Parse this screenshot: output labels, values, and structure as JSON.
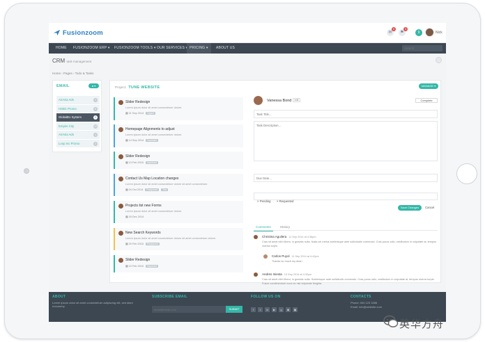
{
  "brand": {
    "name": "Fusionzoom"
  },
  "topbar": {
    "badge1": "5",
    "badge2": "3",
    "green_badge": "9",
    "user": "Nick"
  },
  "nav": {
    "items": [
      "HOME",
      "FUSIONZOOM ERP ▾",
      "FUSIONZOOM TOOLS ▾",
      "OUR SERVICES ▾",
      "PRICING ▾",
      "ABOUT US"
    ],
    "search_placeholder": "Search"
  },
  "page": {
    "title": "CRM",
    "subtitle": "task management",
    "breadcrumb": "Home  ›  Pages  ›  Todo & Tasks"
  },
  "sidebar": {
    "title": "EMAIL",
    "toggle": "● ▾",
    "items": [
      {
        "label": "AirAsia Ads",
        "count": "3"
      },
      {
        "label": "HSBC Promo",
        "count": "5"
      },
      {
        "label": "GlobalEx System",
        "count": "2"
      },
      {
        "label": "Empire City",
        "count": "10"
      },
      {
        "label": "AirAsia Ads",
        "count": "4"
      },
      {
        "label": "Loop Inc Promo",
        "count": "2"
      }
    ]
  },
  "main": {
    "project_label": "Project:",
    "project_name": "TUNE WEBSITE",
    "manage_label": "MANAGE ▾"
  },
  "tasks": [
    {
      "title": "Slider Redesign",
      "desc": "Lorem ipsum dolor sit amet consectetuer dolore.",
      "date": "21 Sep 2014",
      "tag": "Urgent"
    },
    {
      "title": "Homepage Alignments to adjust",
      "desc": "Lorem ipsum dolor sit amet consectetuer dolore.",
      "date": "14 Sep 2014",
      "tag": "Important"
    },
    {
      "title": "Slider Redesign",
      "desc": "",
      "date": "10 Feb 2015",
      "tag": "Important"
    },
    {
      "title": "Contact Us Map Location changes",
      "desc": "Lorem ipsum dolor sit amet consectetuer dolore sit amet consectetuer.",
      "date": "04 Oct 2014",
      "tag": "Postponed",
      "tag2": "Test"
    },
    {
      "title": "Projects list new Forms",
      "desc": "Lorem ipsum dolor sit amet consectetuer dolore.",
      "date": "18 Dec 2014",
      "tag": ""
    },
    {
      "title": "New Search Keywords",
      "desc": "Lorem ipsum dolor sit amet consectetuer dolore sit amet consectetuer dolore.",
      "date": "20 Feb 2015",
      "tag": "Postponed"
    },
    {
      "title": "Slider Redesign",
      "desc": "",
      "date": "10 Feb 2015",
      "tag": "Important"
    }
  ],
  "detail": {
    "name": "Vanessa Bond",
    "edit_label": "edit",
    "complete_label": "Complete",
    "task_title_placeholder": "Task Title...",
    "task_desc_placeholder": "Task Description...",
    "due_date_placeholder": "Due Date...",
    "chip1": "× Pending",
    "chip2": "× Requested",
    "save_label": "Save Changes",
    "cancel_label": "Cancel",
    "tab_comments": "Comments",
    "tab_history": "History"
  },
  "comments": [
    {
      "name": "Christina Aguilera",
      "time": "11 Sep 2014 at 4:36pm",
      "text": "Cras sit amet nibh libero, in gravida nulla. Nulla vel metus scelerisque ante sollicitudin commodo. Cras purus odio, vestibulum in vulputate at, tempus viverra turpis."
    },
    {
      "name": "Carlos Puyol",
      "time": "11 Sep 2014 at 4:42pm",
      "text": "Thanks so much my dear!"
    },
    {
      "name": "Andres Iniesta",
      "time": "10 Sep 2014 at 4:32pm",
      "text": "Cras sit amet nibh libero, in gravida nulla. Scelerisque ante sollicitudin commodo. Cras purus odio, vestibulum in vulputate at, tempus viverra turpis. Fusce condimentum nunc ac nisi vulputate fringilla."
    }
  ],
  "footer": {
    "about_title": "ABOUT",
    "about_text": "Lorem ipsum dolor sit amet consectetuer adipiscing elit, sed diam nonummy.",
    "subscribe_title": "SUBSCRIBE EMAIL",
    "email_placeholder": "email@email.com",
    "submit_label": "SUBMIT",
    "follow_title": "FOLLOW US ON",
    "contacts_title": "CONTACTS",
    "phone": "Phone: 000 123 3456",
    "email": "Email: info@website.com"
  },
  "watermark": {
    "text": "英华方舟"
  }
}
